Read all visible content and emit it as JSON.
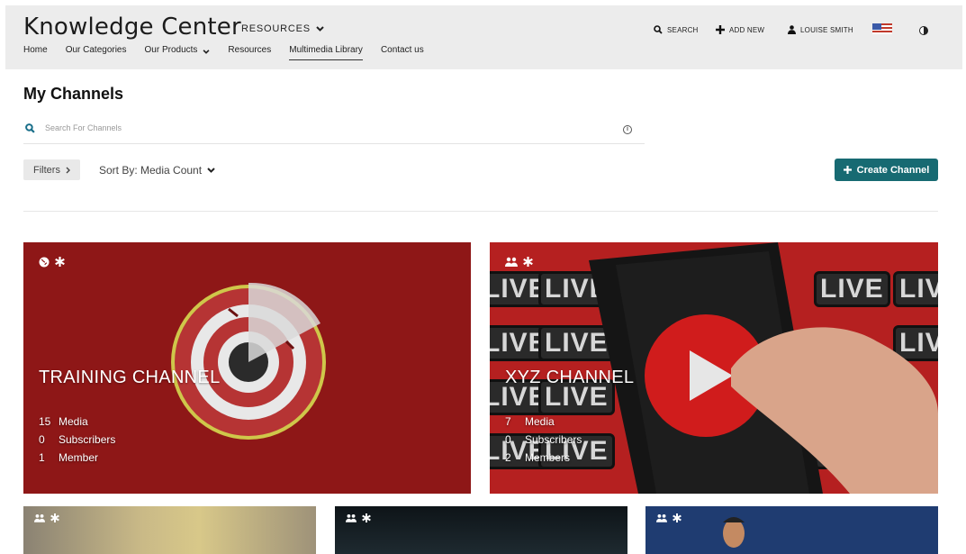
{
  "header": {
    "site_title": "Knowledge Center",
    "resources_label": "RESOURCES",
    "nav": [
      {
        "label": "Home"
      },
      {
        "label": "Our Categories"
      },
      {
        "label": "Our Products"
      },
      {
        "label": "Resources"
      },
      {
        "label": "Multimedia Library"
      },
      {
        "label": "Contact us"
      }
    ],
    "search_label": "SEARCH",
    "add_new_label": "ADD NEW",
    "user_label": "LOUISE SMITH"
  },
  "page": {
    "title": "My Channels",
    "search_placeholder": "Search For Channels",
    "filters_label": "Filters",
    "sort_label": "Sort By: Media Count",
    "create_label": "Create Channel"
  },
  "channels": [
    {
      "title": "TRAINING CHANNEL",
      "media_count": "15",
      "media_label": "Media",
      "subscribers_count": "0",
      "subscribers_label": "Subscribers",
      "members_count": "1",
      "members_label": "Member"
    },
    {
      "title": "XYZ CHANNEL",
      "media_count": "7",
      "media_label": "Media",
      "subscribers_count": "0",
      "subscribers_label": "Subscribers",
      "members_count": "2",
      "members_label": "Members"
    }
  ],
  "live_text": "LIVE",
  "colors": {
    "accent": "#176a72",
    "header_bg": "#ececec"
  }
}
